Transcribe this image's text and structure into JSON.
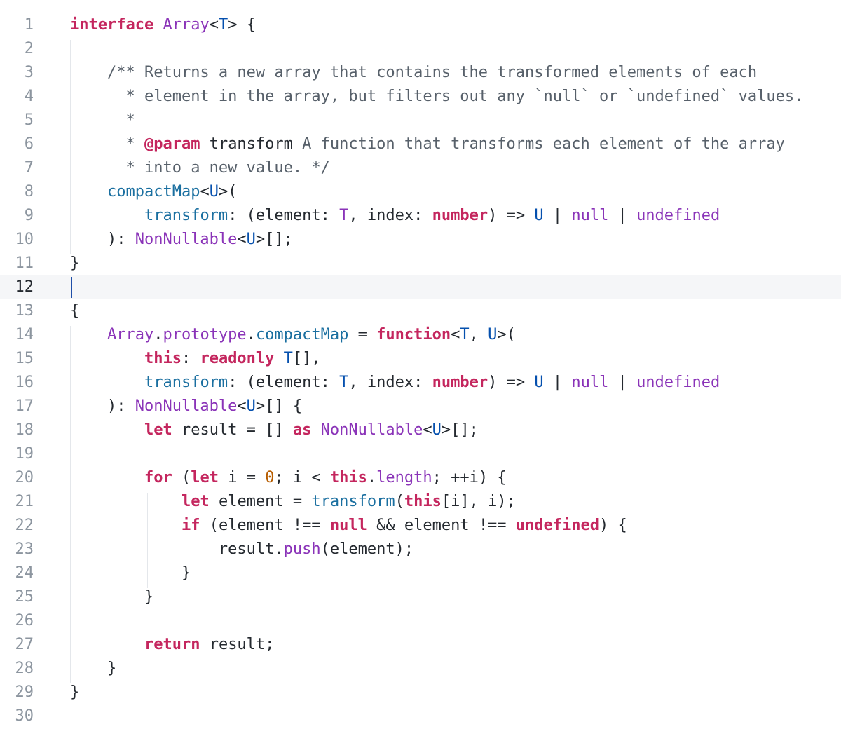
{
  "editor": {
    "active_line": 12,
    "colors": {
      "keyword": "#c4265e",
      "type": "#8a33b8",
      "type_param": "#0550ae",
      "function": "#1a6fa0",
      "comment": "#57606a",
      "number": "#b75d00",
      "active_line_bg": "#f5f6f8"
    },
    "lines": [
      {
        "n": "1",
        "tokens": [
          [
            "kw",
            "interface"
          ],
          [
            "pl",
            " "
          ],
          [
            "ty",
            "Array"
          ],
          [
            "pl",
            "<"
          ],
          [
            "tp",
            "T"
          ],
          [
            "pl",
            "> {"
          ]
        ]
      },
      {
        "n": "2",
        "tokens": []
      },
      {
        "n": "3",
        "tokens": [
          [
            "pl",
            "    "
          ],
          [
            "cm",
            "/** Returns a new array that contains the transformed elements of each"
          ]
        ]
      },
      {
        "n": "4",
        "tokens": [
          [
            "pl",
            "    "
          ],
          [
            "cm",
            "  * element in the array, but filters out any `null` or `undefined` values."
          ]
        ]
      },
      {
        "n": "5",
        "tokens": [
          [
            "pl",
            "    "
          ],
          [
            "cm",
            "  *"
          ]
        ]
      },
      {
        "n": "6",
        "tokens": [
          [
            "pl",
            "    "
          ],
          [
            "cm",
            "  * "
          ],
          [
            "tag",
            "@param"
          ],
          [
            "pl",
            " transform"
          ],
          [
            "cm",
            " A function that transforms each element of the array"
          ]
        ]
      },
      {
        "n": "7",
        "tokens": [
          [
            "pl",
            "    "
          ],
          [
            "cm",
            "  * into a new value. */"
          ]
        ]
      },
      {
        "n": "8",
        "tokens": [
          [
            "pl",
            "    "
          ],
          [
            "fn",
            "compactMap"
          ],
          [
            "pl",
            "<"
          ],
          [
            "tp",
            "U"
          ],
          [
            "pl",
            ">("
          ]
        ]
      },
      {
        "n": "9",
        "tokens": [
          [
            "pl",
            "        "
          ],
          [
            "fn",
            "transform"
          ],
          [
            "pl",
            ": (element: "
          ],
          [
            "ty",
            "T"
          ],
          [
            "pl",
            ", index: "
          ],
          [
            "kw",
            "number"
          ],
          [
            "pl",
            ") => "
          ],
          [
            "tp",
            "U"
          ],
          [
            "pl",
            " | "
          ],
          [
            "ty",
            "null"
          ],
          [
            "pl",
            " | "
          ],
          [
            "ty",
            "undefined"
          ]
        ]
      },
      {
        "n": "10",
        "tokens": [
          [
            "pl",
            "    ): "
          ],
          [
            "ty",
            "NonNullable"
          ],
          [
            "pl",
            "<"
          ],
          [
            "tp",
            "U"
          ],
          [
            "pl",
            ">[];"
          ]
        ]
      },
      {
        "n": "11",
        "tokens": [
          [
            "pl",
            "}"
          ]
        ]
      },
      {
        "n": "12",
        "tokens": []
      },
      {
        "n": "13",
        "tokens": [
          [
            "pl",
            "{"
          ]
        ]
      },
      {
        "n": "14",
        "tokens": [
          [
            "pl",
            "    "
          ],
          [
            "ty",
            "Array"
          ],
          [
            "pl",
            "."
          ],
          [
            "pr",
            "prototype"
          ],
          [
            "pl",
            "."
          ],
          [
            "fn",
            "compactMap"
          ],
          [
            "pl",
            " = "
          ],
          [
            "kw",
            "function"
          ],
          [
            "pl",
            "<"
          ],
          [
            "tp",
            "T"
          ],
          [
            "pl",
            ", "
          ],
          [
            "tp",
            "U"
          ],
          [
            "pl",
            ">("
          ]
        ]
      },
      {
        "n": "15",
        "tokens": [
          [
            "pl",
            "        "
          ],
          [
            "kw",
            "this"
          ],
          [
            "pl",
            ": "
          ],
          [
            "kw",
            "readonly"
          ],
          [
            "pl",
            " "
          ],
          [
            "tp",
            "T"
          ],
          [
            "pl",
            "[],"
          ]
        ]
      },
      {
        "n": "16",
        "tokens": [
          [
            "pl",
            "        "
          ],
          [
            "fn",
            "transform"
          ],
          [
            "pl",
            ": (element: "
          ],
          [
            "tp",
            "T"
          ],
          [
            "pl",
            ", index: "
          ],
          [
            "kw",
            "number"
          ],
          [
            "pl",
            ") => "
          ],
          [
            "tp",
            "U"
          ],
          [
            "pl",
            " | "
          ],
          [
            "ty",
            "null"
          ],
          [
            "pl",
            " | "
          ],
          [
            "ty",
            "undefined"
          ]
        ]
      },
      {
        "n": "17",
        "tokens": [
          [
            "pl",
            "    ): "
          ],
          [
            "ty",
            "NonNullable"
          ],
          [
            "pl",
            "<"
          ],
          [
            "tp",
            "U"
          ],
          [
            "pl",
            ">[] {"
          ]
        ]
      },
      {
        "n": "18",
        "tokens": [
          [
            "pl",
            "        "
          ],
          [
            "kw",
            "let"
          ],
          [
            "pl",
            " result = [] "
          ],
          [
            "kw",
            "as"
          ],
          [
            "pl",
            " "
          ],
          [
            "ty",
            "NonNullable"
          ],
          [
            "pl",
            "<"
          ],
          [
            "tp",
            "U"
          ],
          [
            "pl",
            ">[];"
          ]
        ]
      },
      {
        "n": "19",
        "tokens": []
      },
      {
        "n": "20",
        "tokens": [
          [
            "pl",
            "        "
          ],
          [
            "kw",
            "for"
          ],
          [
            "pl",
            " ("
          ],
          [
            "kw",
            "let"
          ],
          [
            "pl",
            " i = "
          ],
          [
            "num",
            "0"
          ],
          [
            "pl",
            "; i < "
          ],
          [
            "kw",
            "this"
          ],
          [
            "pl",
            "."
          ],
          [
            "pr",
            "length"
          ],
          [
            "pl",
            "; ++i) {"
          ]
        ]
      },
      {
        "n": "21",
        "tokens": [
          [
            "pl",
            "            "
          ],
          [
            "kw",
            "let"
          ],
          [
            "pl",
            " element = "
          ],
          [
            "fn",
            "transform"
          ],
          [
            "pl",
            "("
          ],
          [
            "kw",
            "this"
          ],
          [
            "pl",
            "[i], i);"
          ]
        ]
      },
      {
        "n": "22",
        "tokens": [
          [
            "pl",
            "            "
          ],
          [
            "kw",
            "if"
          ],
          [
            "pl",
            " (element !== "
          ],
          [
            "kw",
            "null"
          ],
          [
            "pl",
            " && element !== "
          ],
          [
            "kw",
            "undefined"
          ],
          [
            "pl",
            ") {"
          ]
        ]
      },
      {
        "n": "23",
        "tokens": [
          [
            "pl",
            "                result."
          ],
          [
            "pr",
            "push"
          ],
          [
            "pl",
            "(element);"
          ]
        ]
      },
      {
        "n": "24",
        "tokens": [
          [
            "pl",
            "            }"
          ]
        ]
      },
      {
        "n": "25",
        "tokens": [
          [
            "pl",
            "        }"
          ]
        ]
      },
      {
        "n": "26",
        "tokens": []
      },
      {
        "n": "27",
        "tokens": [
          [
            "pl",
            "        "
          ],
          [
            "kw",
            "return"
          ],
          [
            "pl",
            " result;"
          ]
        ]
      },
      {
        "n": "28",
        "tokens": [
          [
            "pl",
            "    }"
          ]
        ]
      },
      {
        "n": "29",
        "tokens": [
          [
            "pl",
            "}"
          ]
        ]
      },
      {
        "n": "30",
        "tokens": []
      }
    ]
  }
}
